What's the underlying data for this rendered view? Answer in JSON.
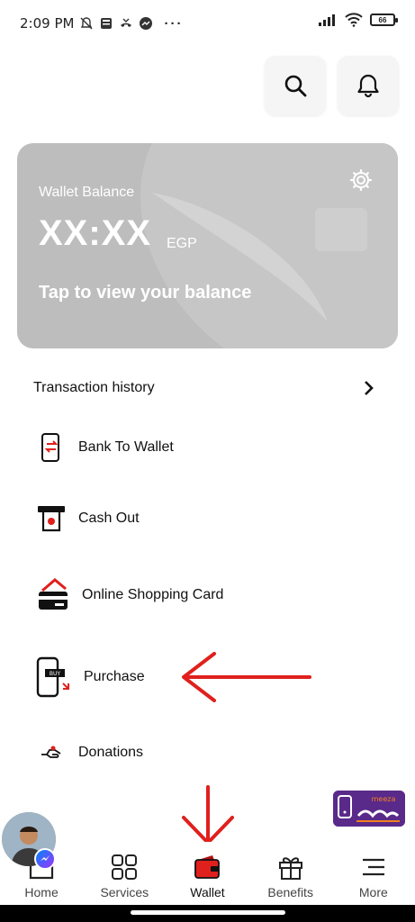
{
  "status_bar": {
    "time": "2:09 PM",
    "overflow": "···",
    "battery": "66"
  },
  "header": {
    "search_icon": "search-icon",
    "bell_icon": "bell-icon"
  },
  "wallet_card": {
    "label": "Wallet Balance",
    "amount": "XX:XX",
    "currency": "EGP",
    "tap_text": "Tap to view your balance"
  },
  "transaction_history": {
    "label": "Transaction history"
  },
  "menu": {
    "bank_to_wallet": "Bank To Wallet",
    "cash_out": "Cash Out",
    "online_shopping_card": "Online Shopping Card",
    "purchase": "Purchase",
    "donations": "Donations"
  },
  "purchase_icon_tag": "BUY",
  "meeza": {
    "top": "meeza"
  },
  "nav": {
    "home": "Home",
    "services": "Services",
    "wallet": "Wallet",
    "benefits": "Benefits",
    "more": "More"
  },
  "colors": {
    "accent": "#e0201c",
    "card": "#bdbdbd",
    "meeza": "#5a2a8a"
  }
}
